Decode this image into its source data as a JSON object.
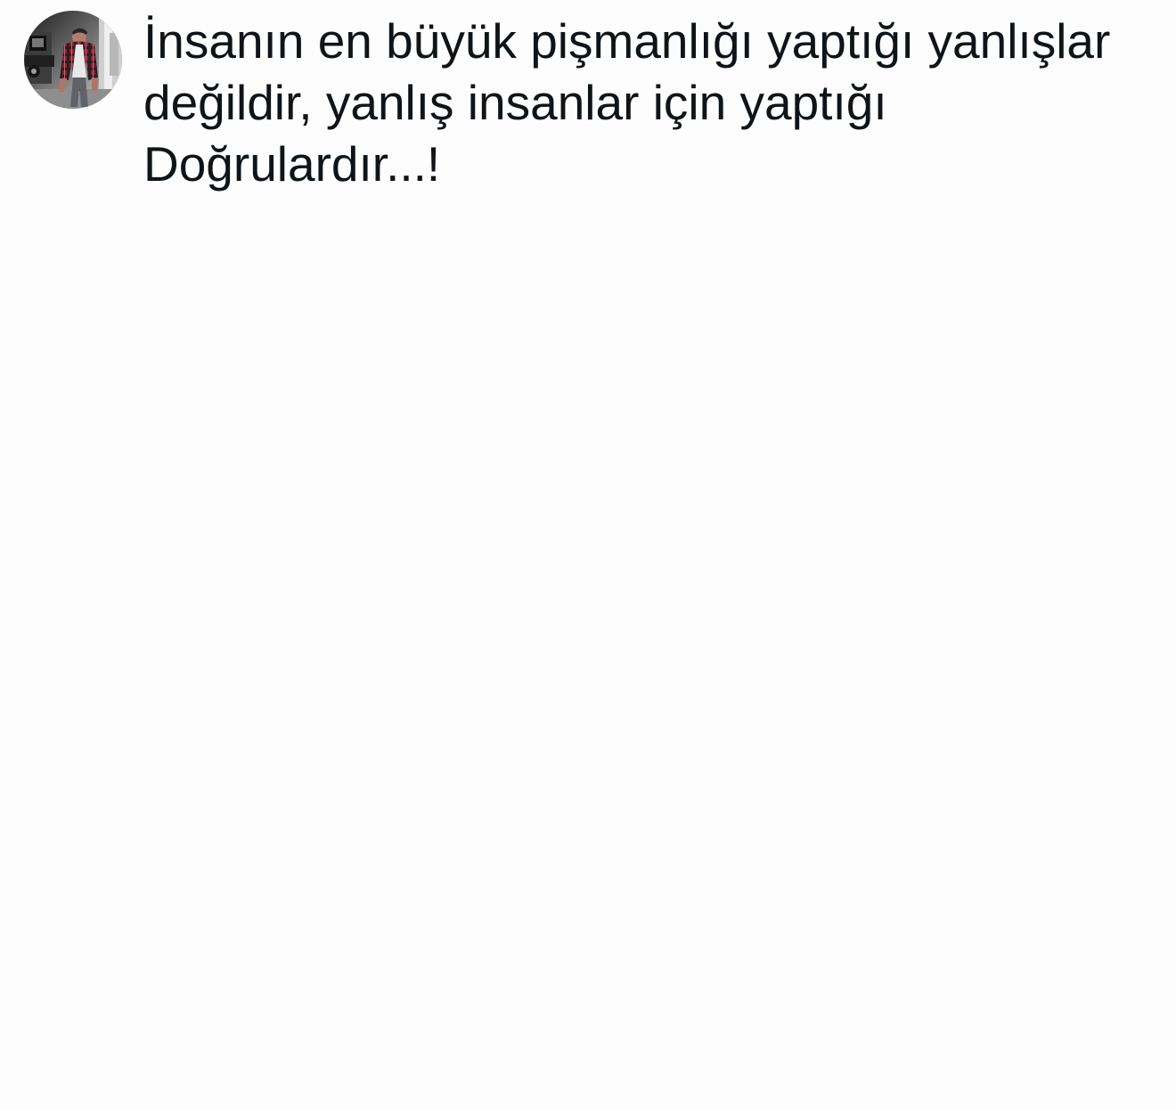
{
  "tweet": {
    "avatar": {
      "icon": "profile-photo-icon"
    },
    "text": "İnsanın en büyük pişmanlığı yaptığı yanlışlar değildir, yanlış insanlar için yaptığı Doğrulardır...!"
  },
  "colors": {
    "background": "#fdfdfd",
    "text": "#0f1419"
  }
}
